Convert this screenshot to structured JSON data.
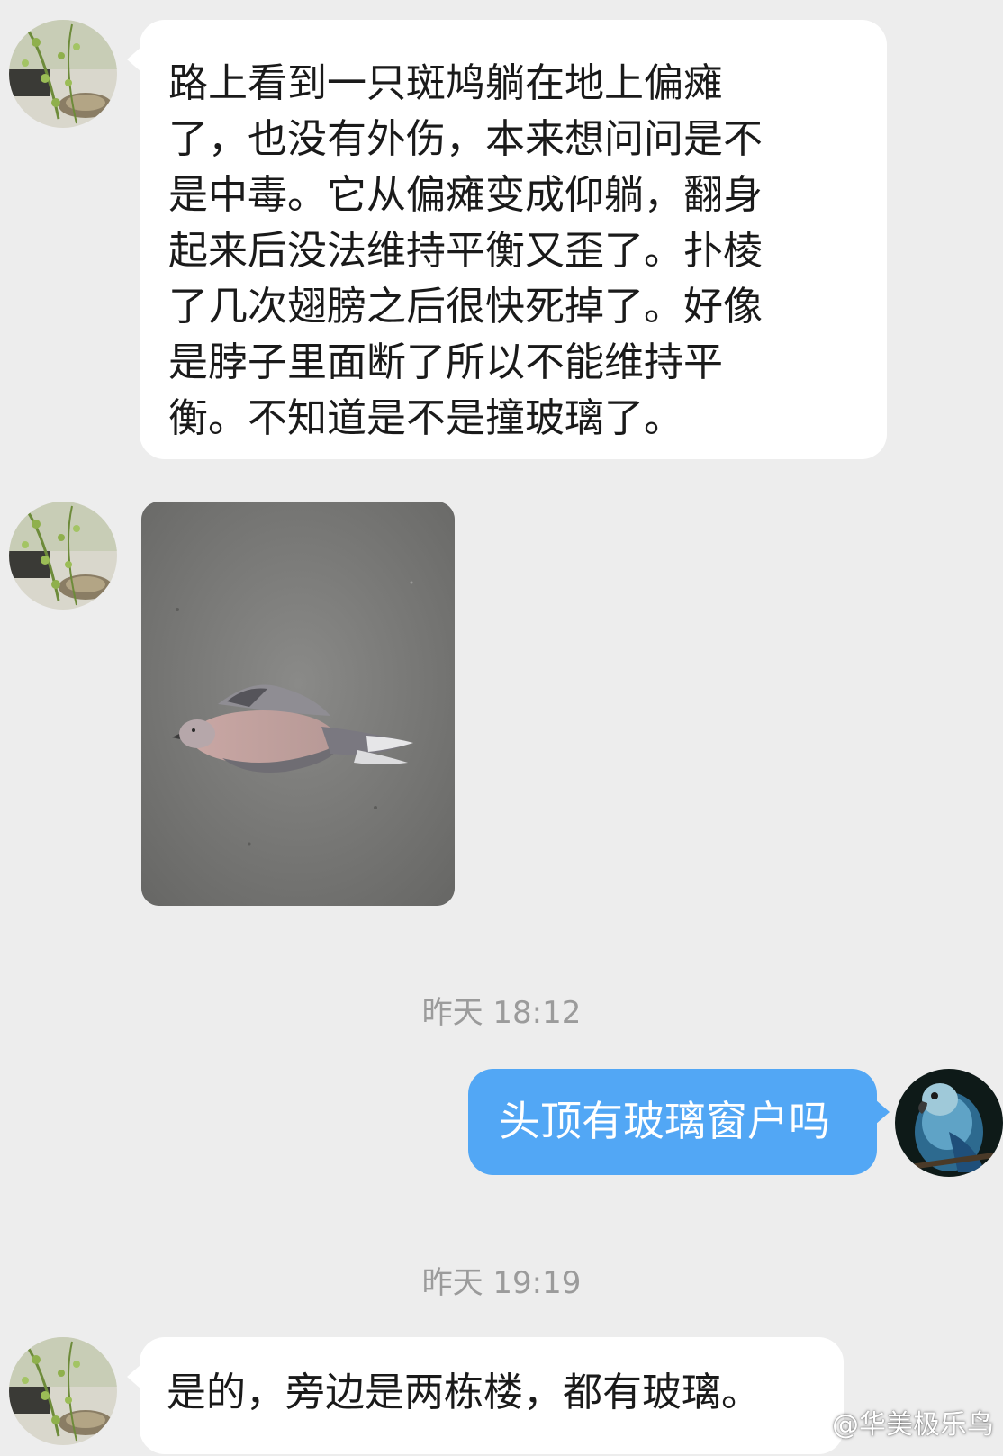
{
  "colors": {
    "background": "#ededed",
    "incoming_bubble": "#ffffff",
    "outgoing_bubble": "#52a7f5",
    "timestamp_text": "#9b9b9b"
  },
  "messages": [
    {
      "sender": "other",
      "type": "text",
      "avatar": "plant-avatar-icon",
      "lines": [
        "路上看到一只斑鸠躺在地上偏瘫",
        "了，也没有外伤，本来想问问是不",
        "是中毒。它从偏瘫变成仰躺，翻身",
        "起来后没法维持平衡又歪了。扑棱",
        "了几次翅膀之后很快死掉了。好像",
        "是脖子里面断了所以不能维持平",
        "衡。不知道是不是撞玻璃了。"
      ]
    },
    {
      "sender": "other",
      "type": "image",
      "avatar": "plant-avatar-icon",
      "image": "dead-dove-photo"
    },
    {
      "type": "timestamp",
      "text": "昨天 18:12"
    },
    {
      "sender": "me",
      "type": "text",
      "avatar": "parrot-avatar-icon",
      "text": "头顶有玻璃窗户吗"
    },
    {
      "type": "timestamp",
      "text": "昨天 19:19"
    },
    {
      "sender": "other",
      "type": "text",
      "avatar": "plant-avatar-icon",
      "text": "是的，旁边是两栋楼，都有玻璃。"
    }
  ],
  "watermark": {
    "icon": "weibo-icon",
    "text": "@华美极乐鸟"
  }
}
